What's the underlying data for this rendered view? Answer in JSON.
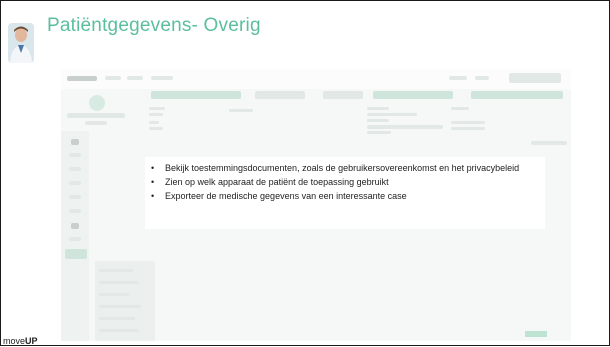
{
  "slide": {
    "title": "Patiëntgegevens- Overig",
    "bullets": [
      "Bekijk toestemmingsdocumenten, zoals de gebruikersovereenkomst en het privacybeleid",
      "Zien op welk apparaat de patiënt de toepassing gebruikt",
      "Exporteer de medische gegevens van een interessante case"
    ],
    "bullet_marker": "•",
    "logo_prefix": "move",
    "logo_suffix": "UP"
  },
  "icons": [
    "doctor-avatar-icon"
  ],
  "colors": {
    "title": "#5bbf9c",
    "accent_soft": "#cfe4da"
  }
}
